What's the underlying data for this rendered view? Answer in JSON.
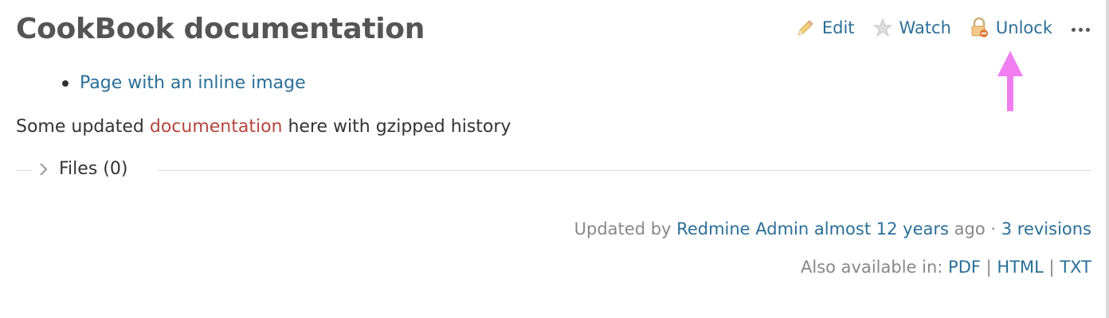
{
  "page": {
    "title": "CookBook documentation"
  },
  "contextual": {
    "edit_label": "Edit",
    "watch_label": "Watch",
    "unlock_label": "Unlock",
    "edit_icon": "pencil-icon",
    "watch_icon": "star-icon",
    "unlock_icon": "lock-icon",
    "more_icon": "ellipsis-icon"
  },
  "content": {
    "toc_items": [
      {
        "label": "Page with an inline image"
      }
    ],
    "paragraph": {
      "before": "Some updated ",
      "link": "documentation",
      "after": " here with gzipped history"
    }
  },
  "attachments": {
    "label": "Files (0)"
  },
  "footer": {
    "updated_prefix": "Updated by",
    "author": "Redmine Admin",
    "when": "almost 12 years",
    "ago": "ago",
    "separator": "·",
    "revisions": "3 revisions",
    "also_label": "Also available in:",
    "formats": [
      "PDF",
      "HTML",
      "TXT"
    ],
    "format_separator": "|"
  },
  "colors": {
    "link": "#2a6f97",
    "missing_link": "#b5473f",
    "annotation_arrow": "#f07ef0"
  }
}
